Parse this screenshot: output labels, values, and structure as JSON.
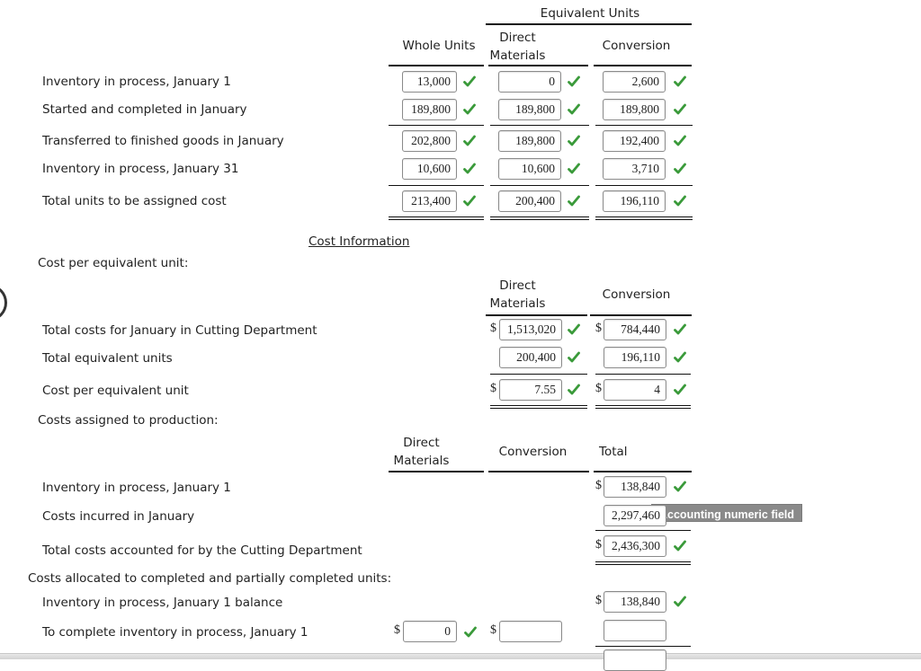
{
  "units_table": {
    "group_header": "Equivalent Units",
    "col_whole": "Whole Units",
    "col_dm": "Direct Materials",
    "col_conv": "Conversion",
    "rows": [
      {
        "label": "Inventory in process, January 1",
        "whole": "13,000",
        "dm": "0",
        "conv": "2,600"
      },
      {
        "label": "Started and completed in January",
        "whole": "189,800",
        "dm": "189,800",
        "conv": "189,800"
      },
      {
        "label": "Transferred to finished goods in January",
        "whole": "202,800",
        "dm": "189,800",
        "conv": "192,400"
      },
      {
        "label": "Inventory in process, January 31",
        "whole": "10,600",
        "dm": "10,600",
        "conv": "3,710"
      },
      {
        "label": "Total units to be assigned cost",
        "whole": "213,400",
        "dm": "200,400",
        "conv": "196,110"
      }
    ]
  },
  "cost_info_link": "Cost Information",
  "cost_per_unit": {
    "section_label": "Cost per equivalent unit:",
    "col_dm": "Direct Materials",
    "col_conv": "Conversion",
    "currency": "$",
    "rows": [
      {
        "label": "Total costs for January in Cutting Department",
        "dm": "1,513,020",
        "conv": "784,440"
      },
      {
        "label": "Total equivalent units",
        "dm": "200,400",
        "conv": "196,110"
      },
      {
        "label": "Cost per equivalent unit",
        "dm": "7.55",
        "conv": "4"
      }
    ]
  },
  "costs_assigned": {
    "section_label": "Costs assigned to production:",
    "col_dm": "Direct Materials",
    "col_conv": "Conversion",
    "col_total": "Total",
    "currency": "$",
    "rows": [
      {
        "label": "Inventory in process, January 1",
        "total": "138,840"
      },
      {
        "label": "Costs incurred in January",
        "total": "2,297,460"
      },
      {
        "label": "Total costs accounted for by the Cutting Department",
        "total": "2,436,300"
      }
    ],
    "tooltip": "Accounting numeric field"
  },
  "allocated": {
    "section_label": "Costs allocated to completed and partially completed units:",
    "rows": [
      {
        "label": "Inventory in process, January 1 balance",
        "total": "138,840"
      },
      {
        "label": "To complete inventory in process, January 1",
        "dm": "0",
        "conv": "",
        "total": ""
      }
    ]
  },
  "colors": {
    "check": "#3a9a3a",
    "rule": "#111111"
  }
}
